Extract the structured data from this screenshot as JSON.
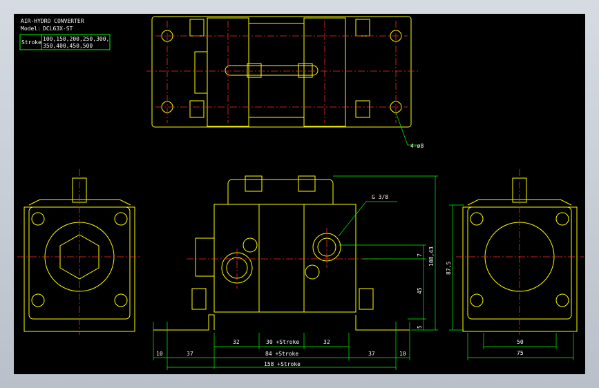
{
  "title_block": {
    "title": "AIR-HYDRO CONVERTER",
    "model_label": "Model:",
    "model_value": "DCL63X-ST",
    "stroke_label": "Stroke",
    "stroke_values_line1": "100,150,200,250,300,",
    "stroke_values_line2": "350,400,450,500"
  },
  "callouts": {
    "holes": "4-ø8",
    "port": "G 3/8"
  },
  "dimensions": {
    "horizontal": {
      "a_32_left": "32",
      "a_30_stroke": "30 +Stroke",
      "a_32_right": "32",
      "b_10_left": "10",
      "b_37_left": "37",
      "b_84_stroke": "84 +Stroke",
      "b_37_right": "37",
      "b_10_right": "10",
      "c_158_stroke": "158 +Stroke",
      "right_50": "50",
      "right_75": "75"
    },
    "vertical": {
      "v_108": "108,43",
      "v_7": "7",
      "v_45": "45",
      "v_5": "5",
      "v_875": "87,5"
    }
  },
  "colors": {
    "background": "#000000",
    "outline": "#ffff00",
    "centerline": "#ff2a2a",
    "dimension": "#00ff00",
    "text": "#ffffff"
  }
}
